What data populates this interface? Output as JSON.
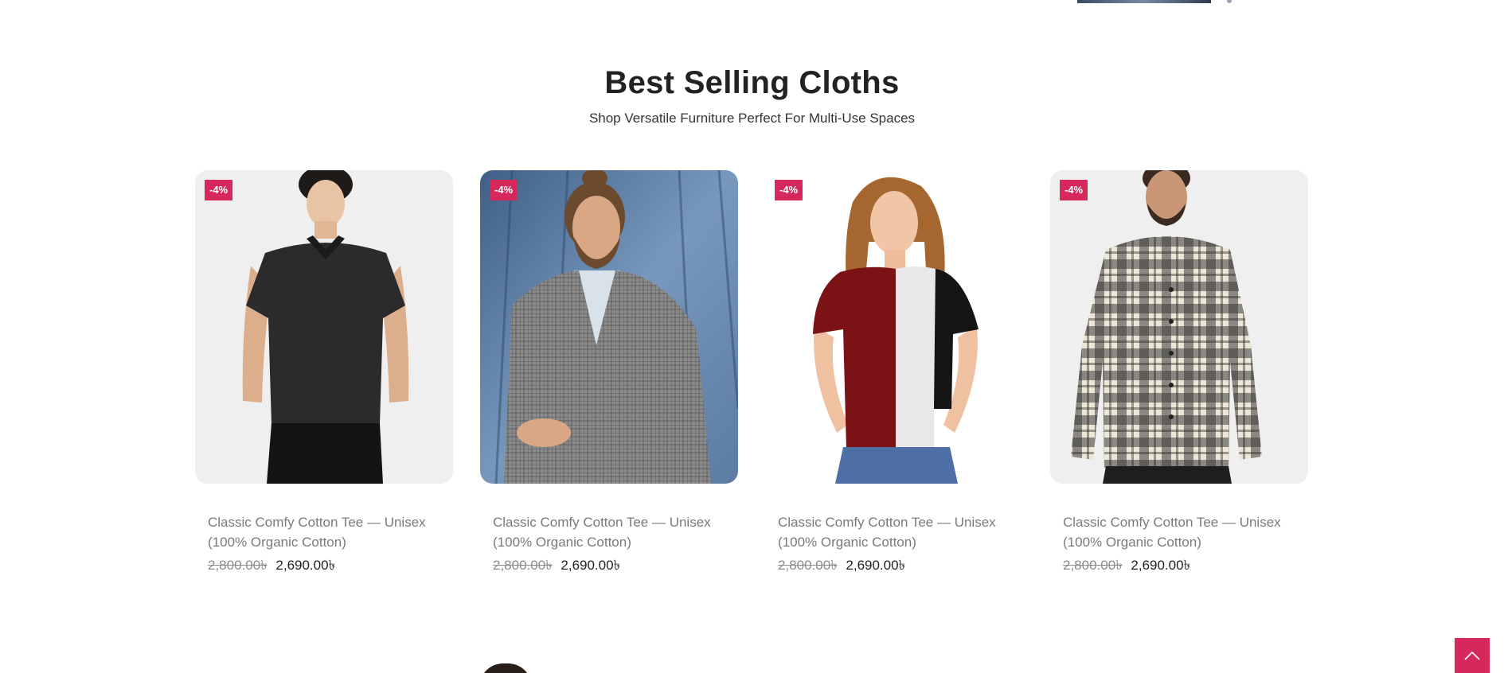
{
  "section": {
    "title": "Best Selling Cloths",
    "subtitle": "Shop Versatile Furniture Perfect For Multi-Use Spaces"
  },
  "products": [
    {
      "badge": "-4%",
      "title": "Classic Comfy Cotton Tee — Unisex (100% Organic Cotton)",
      "old_price": "2,800.00৳",
      "new_price": "2,690.00৳",
      "image": "man-black-polo-shirt"
    },
    {
      "badge": "-4%",
      "title": "Classic Comfy Cotton Tee — Unisex (100% Organic Cotton)",
      "old_price": "2,800.00৳",
      "new_price": "2,690.00৳",
      "image": "man-grey-plaid-blazer"
    },
    {
      "badge": "-4%",
      "title": "Classic Comfy Cotton Tee — Unisex (100% Organic Cotton)",
      "old_price": "2,800.00৳",
      "new_price": "2,690.00৳",
      "image": "woman-colorblock-tee"
    },
    {
      "badge": "-4%",
      "title": "Classic Comfy Cotton Tee — Unisex (100% Organic Cotton)",
      "old_price": "2,800.00৳",
      "new_price": "2,690.00৳",
      "image": "man-plaid-flannel-shirt"
    }
  ],
  "colors": {
    "accent": "#d6285a",
    "title": "#222222",
    "muted": "#7a7a7a"
  },
  "icons": {
    "scroll_top": "chevron-up-icon"
  }
}
